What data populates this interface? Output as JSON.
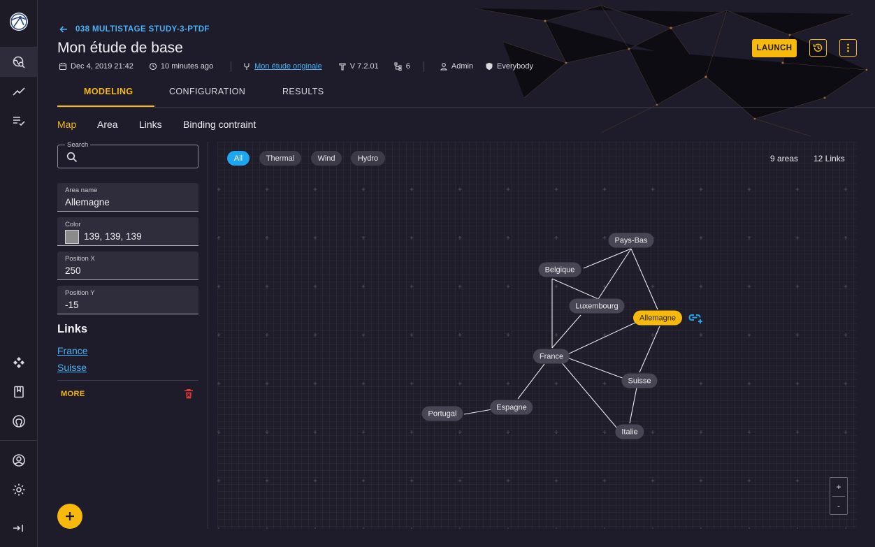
{
  "colors": {
    "accent": "#f6b90c",
    "link": "#4ab2f5",
    "chip_active": "#1ea6f0",
    "node": "#484654"
  },
  "sidebar": {
    "logo": "antares-logo",
    "items": [
      {
        "icon": "travel-explore-icon",
        "active": true
      },
      {
        "icon": "trending-up-icon",
        "active": false
      },
      {
        "icon": "playlist-check-icon",
        "active": false
      },
      {
        "icon": "hub-icon",
        "active": false
      },
      {
        "icon": "book-icon",
        "active": false
      },
      {
        "icon": "github-icon",
        "active": false
      },
      {
        "icon": "account-circle-icon",
        "active": false
      },
      {
        "icon": "settings-icon",
        "active": false
      },
      {
        "icon": "collapse-menu-icon",
        "active": false
      }
    ]
  },
  "header": {
    "back_label": "038 MULTISTAGE STUDY-3-PTDF",
    "title": "Mon étude de base",
    "meta": {
      "created": "Dec 4, 2019 21:42",
      "updated": "10 minutes ago",
      "parent_link": "Mon étude originale",
      "version": "V 7.2.01",
      "variants": "6",
      "owner": "Admin",
      "group": "Everybody"
    },
    "launch_label": "LAUNCH"
  },
  "tabs": [
    {
      "label": "MODELING",
      "active": true
    },
    {
      "label": "CONFIGURATION",
      "active": false
    },
    {
      "label": "RESULTS",
      "active": false
    }
  ],
  "subtabs": [
    {
      "label": "Map",
      "active": true
    },
    {
      "label": "Area",
      "active": false
    },
    {
      "label": "Links",
      "active": false
    },
    {
      "label": "Binding contraint",
      "active": false
    }
  ],
  "panel": {
    "search_label": "Search",
    "fields": {
      "area_name": {
        "label": "Area name",
        "value": "Allemagne"
      },
      "color": {
        "label": "Color",
        "value": "139, 139, 139",
        "swatch": "#8b8b8b"
      },
      "position_x": {
        "label": "Position X",
        "value": "250"
      },
      "position_y": {
        "label": "Position Y",
        "value": "-15"
      }
    },
    "links_title": "Links",
    "links": [
      "France",
      "Suisse"
    ],
    "more_label": "MORE"
  },
  "map": {
    "filters": [
      {
        "label": "All",
        "active": true
      },
      {
        "label": "Thermal",
        "active": false
      },
      {
        "label": "Wind",
        "active": false
      },
      {
        "label": "Hydro",
        "active": false
      }
    ],
    "areas_count": "9 areas",
    "links_count": "12 Links",
    "selected_area": "Allemagne",
    "nodes": [
      "Pays-Bas",
      "Belgique",
      "Luxembourg",
      "Allemagne",
      "France",
      "Suisse",
      "Espagne",
      "Portugal",
      "Italie"
    ],
    "zoom_in_label": "+",
    "zoom_out_label": "-"
  }
}
